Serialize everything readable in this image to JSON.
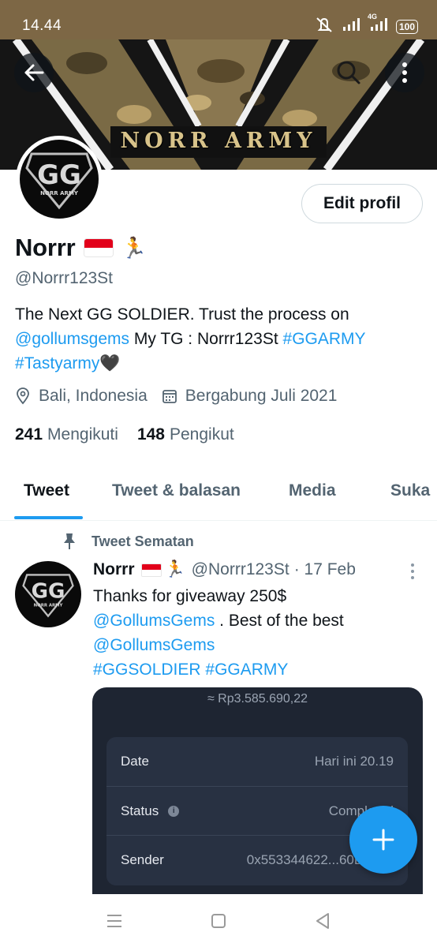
{
  "status_bar": {
    "time": "14.44",
    "network": "4G",
    "battery": "100"
  },
  "banner": {
    "text": "NORR ARMY"
  },
  "avatar": {
    "logo_text": "GG",
    "logo_subtext": "NORR ARMY"
  },
  "profile": {
    "edit_label": "Edit profil",
    "name": "Norrr",
    "flag": "Indonesia flag",
    "emoji": "🏃",
    "handle": "@Norrr123St",
    "bio": {
      "line1": "The Next GG SOLDIER. Trust the process on",
      "mention": "@gollumsgems",
      "tg_text": " My TG : Norrr123St ",
      "hashtag1": "#GGARMY",
      "hashtag2": "#Tastyarmy",
      "heart": "🖤"
    },
    "location": "Bali, Indonesia",
    "joined": "Bergabung Juli 2021",
    "following_count": "241",
    "following_label": "Mengikuti",
    "followers_count": "148",
    "followers_label": "Pengikut"
  },
  "tabs": [
    {
      "label": "Tweet",
      "active": true
    },
    {
      "label": "Tweet & balasan",
      "active": false
    },
    {
      "label": "Media",
      "active": false
    },
    {
      "label": "Suka",
      "active": false
    }
  ],
  "pinned_tweet": {
    "pinned_label": "Tweet Sematan",
    "author_name": "Norrr",
    "author_emoji": "🏃",
    "author_handle": "@Norrr123St",
    "date": "· 17 Feb",
    "text_line1": "Thanks for giveaway 250$",
    "mention1": "@GollumsGems",
    "text_line2": " . Best of the best",
    "mention2": "@GollumsGems",
    "hashtag1": "#GGSOLDIER",
    "hashtag2": "#GGARMY",
    "media": {
      "amount": "≈ Rp3.585.690,22",
      "rows": [
        {
          "label": "Date",
          "value": "Hari ini 20.19"
        },
        {
          "label": "Status",
          "value": "Completed"
        },
        {
          "label": "Sender",
          "value": "0x553344622...60D2e47"
        }
      ]
    }
  },
  "colors": {
    "accent": "#1d9bf0",
    "status_bar": "#7d6745",
    "text_secondary": "#536471"
  }
}
